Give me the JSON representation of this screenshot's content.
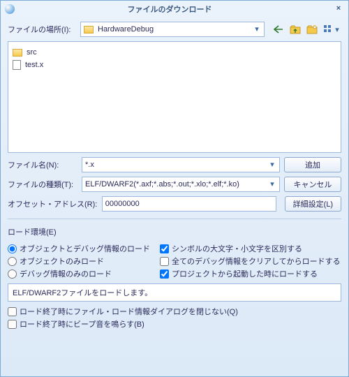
{
  "window": {
    "title": "ファイルのダウンロード"
  },
  "location": {
    "label": "ファイルの場所(I):",
    "value": "HardwareDebug"
  },
  "files": {
    "items": [
      {
        "name": "src",
        "type": "folder"
      },
      {
        "name": "test.x",
        "type": "file"
      }
    ]
  },
  "filename": {
    "label": "ファイル名(N):",
    "value": "*.x"
  },
  "filetype": {
    "label": "ファイルの種類(T):",
    "value": "ELF/DWARF2(*.axf;*.abs;*.out;*.xlo;*.elf;*.ko)"
  },
  "offset": {
    "label": "オフセット・アドレス(R):",
    "value": "00000000"
  },
  "buttons": {
    "add": "追加",
    "cancel": "キャンセル",
    "detail": "詳細設定(L)"
  },
  "loadenv": {
    "group_label": "ロード環境(E)",
    "radios": [
      {
        "label": "オブジェクトとデバッグ情報のロード",
        "checked": true
      },
      {
        "label": "オブジェクトのみロード",
        "checked": false
      },
      {
        "label": "デバッグ情報のみのロード",
        "checked": false
      }
    ],
    "checks": [
      {
        "label": "シンボルの大文字・小文字を区別する",
        "checked": true
      },
      {
        "label": "全てのデバッグ情報をクリアしてからロードする",
        "checked": false
      },
      {
        "label": "プロジェクトから起動した時にロードする",
        "checked": true
      }
    ]
  },
  "status": "ELF/DWARF2ファイルをロードします。",
  "footer_checks": [
    {
      "label": "ロード終了時にファイル・ロード情報ダイアログを閉じない(Q)",
      "checked": false
    },
    {
      "label": "ロード終了時にビープ音を鳴らす(B)",
      "checked": false
    }
  ],
  "icons": {
    "back": "back-arrow",
    "up": "up-folder",
    "new": "new-folder",
    "view": "view-grid"
  }
}
